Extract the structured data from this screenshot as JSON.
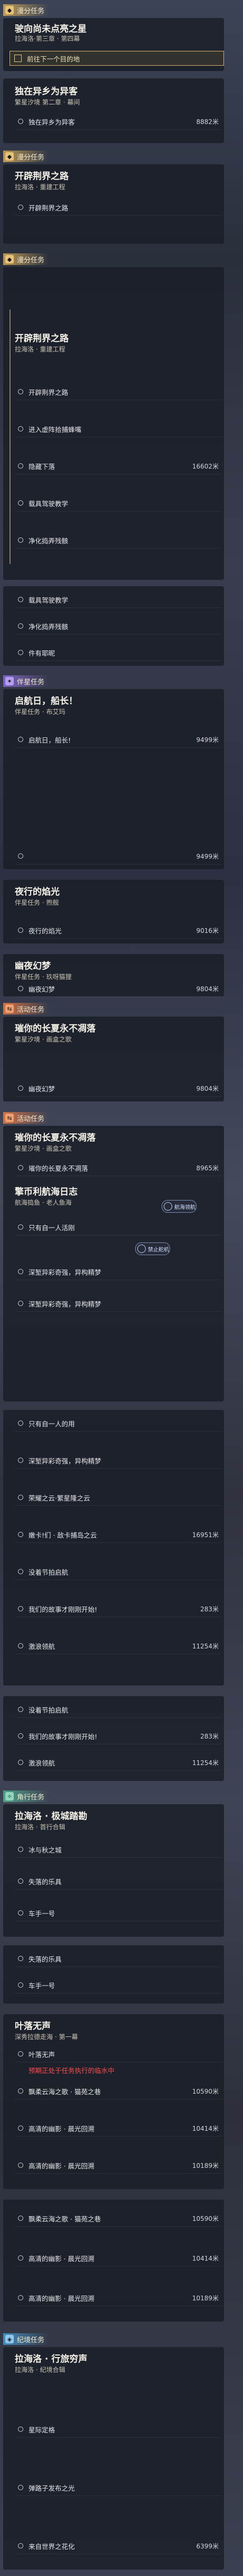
{
  "section_headers": {
    "daily": "漫分任务",
    "event": "活动任务",
    "companion": "伴星任务",
    "trailblaze": "角行任务",
    "warp": "纪境任务"
  },
  "tasks": {
    "t1_title": "驶向尚未点亮之星",
    "t1_sub": "拉海洛·第三章 · 第四幕",
    "t1_goal": "前往下一个目的地",
    "t2_title": "独在异乡为异客",
    "t2_sub": "繁星汐境 第二章 · 幕间",
    "t2_row1": "独在异乡为异客",
    "t2_row1_val": "8882米",
    "t3_title": "开辟荆界之路",
    "t3_sub": "拉海洛 · 重建工程",
    "t3_row1": "开辟荆界之路",
    "t4_title": "开辟荆界之路",
    "t4_sub": "拉海洛 · 重建工程",
    "t4_rows": [
      "开辟荆界之路",
      "进入虚阵拾捕蜂嘴",
      "隐藏下落",
      "载具驾驶教学",
      "净化捣弄残骸"
    ],
    "t4_val": "16602米",
    "t5_rows": [
      "载具驾驶教学",
      "净化捣弄残骸",
      "件有耶昵"
    ],
    "t6_title": "启航日，船长！",
    "t6_sub": "伴星任务 · 布艾玛",
    "t6_row1": "启航日，船长!",
    "t6_val1": "9499米",
    "t6_val2": "9499米",
    "t7_title": "夜行的焰光",
    "t7_sub": "伴星任务 · 煦舰",
    "t7_row1": "夜行的焰光",
    "t7_val": "9016米",
    "t8_title": "夜行的焰光",
    "t8_sub": "伴星任务 · 煦舰",
    "t8_row1": "夜行的焰光",
    "t8_val": "9016米",
    "t9_title": "幽夜幻梦",
    "t9_sub": "伴星任务 · 玖呀猫狸",
    "t9_row1": "幽夜幻梦",
    "t9_val": "9804米",
    "t10_title": "璀你的长夏永不凋落",
    "t10_sub": "繁星汐境 · 画盒之歌",
    "t10_row1": "幽夜幻梦",
    "t10_val": "9804米",
    "t11_title": "璀你的长夏永不凋落",
    "t11_sub": "繁星汐境 · 画盒之歌",
    "t11_row1": "璀你的长夏永不凋落",
    "t11_val": "8965米",
    "t12_title": "擎币利航海日志",
    "t12_sub": "航海捣鱼 · 老人鱼海",
    "t12_rows": [
      "只有自一人活刚",
      "深堑异彩奇强，异构精梦",
      "深堑异彩奇强，异构精梦"
    ],
    "t13_rows": [
      "只有自一人的用",
      "深堑异彩奇强，异构精梦",
      "荣耀之云·繁星隆之云",
      "嫩卡!们 · 敌卡捕岛之云",
      "没着节拍启航",
      "我们的故事才刚刚开始!",
      "激浪领航"
    ],
    "t13_vals": [
      "16951米",
      "283米",
      "11254米"
    ],
    "t14_rows": [
      "没着节拍启航",
      "我们的故事才刚刚开始!",
      "激浪领航"
    ],
    "t14_vals": [
      "283米",
      "11254米"
    ],
    "t15_title": "拉海洛 · 极城踏勘",
    "t15_sub": "拉海洛 · 首行合辑",
    "t15_rows": [
      "冰与秋之城",
      "失落的乐具",
      "车手一号"
    ],
    "t16_rows": [
      "失落的乐具",
      "车手一号"
    ],
    "t17_title": "叶落无声",
    "t17_sub": "深秀拉德走海 · 第一幕",
    "t17_rows": [
      "叶落无声",
      "预期正处于任务执行的临水中",
      "飘柔云海之歌 · 猫苑之巷",
      "高清的幽影 · 晨光回溯",
      "高清的幽影 · 晨光回溯"
    ],
    "t17_vals": [
      "10590米",
      "10414米",
      "10189米"
    ],
    "t18_rows": [
      "飘柔云海之歌 · 猫苑之巷",
      "高清的幽影 · 晨光回溯",
      "高清的幽影 · 晨光回溯"
    ],
    "t18_vals": [
      "10590米",
      "10414米",
      "10189米"
    ],
    "t19_title": "拉海洛 · 行旅穷声",
    "t19_sub": "拉海洛 · 纪境合辑",
    "t19_rows": [
      "星际定格",
      "弹路子发布之光",
      "来自世界之花化"
    ],
    "t19_val": "6399米"
  },
  "pills": {
    "sea_guide": "航海领航",
    "locked": "禁止舵机"
  },
  "colors": {
    "accent_gold": "#d4b46c",
    "danger_red": "#e04545",
    "companion_purple": "#8a6cd6"
  }
}
